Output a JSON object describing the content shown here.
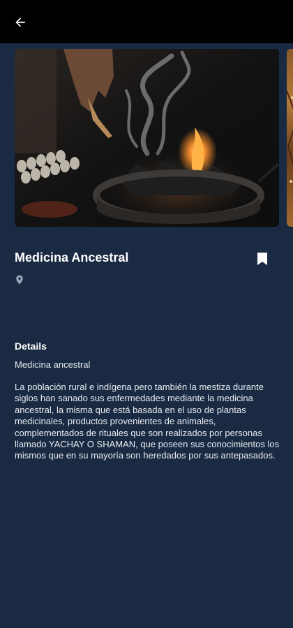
{
  "header": {
    "back_icon": "arrow-left-icon"
  },
  "gallery": {
    "images": [
      {
        "subject": "smoking-bowl-photo",
        "colors": [
          "#141414",
          "#e07a2a"
        ]
      },
      {
        "subject": "partial-next-photo",
        "colors": [
          "#8a5a2a",
          "#b57a3a"
        ]
      }
    ]
  },
  "place": {
    "title": "Medicina Ancestral",
    "bookmark_icon": "bookmark-icon",
    "location_icon": "map-pin-icon",
    "location_text": ""
  },
  "details": {
    "heading": "Details",
    "subtitle": "Medicina ancestral",
    "description": "La población rural e indígena pero también la mestiza durante siglos han sanado sus enfermedades mediante la medicina ancestral, la misma que está basada en el uso de plantas medicinales, productos provenientes de animales, complementados de rituales que son realizados por personas llamado YACHAY O SHAMAN, que poseen sus conocimientos los mismos que en su mayoría son heredados por sus antepasados."
  },
  "colors": {
    "background": "#1b2a43",
    "topbar": "#000000",
    "text": "#ffffff"
  }
}
